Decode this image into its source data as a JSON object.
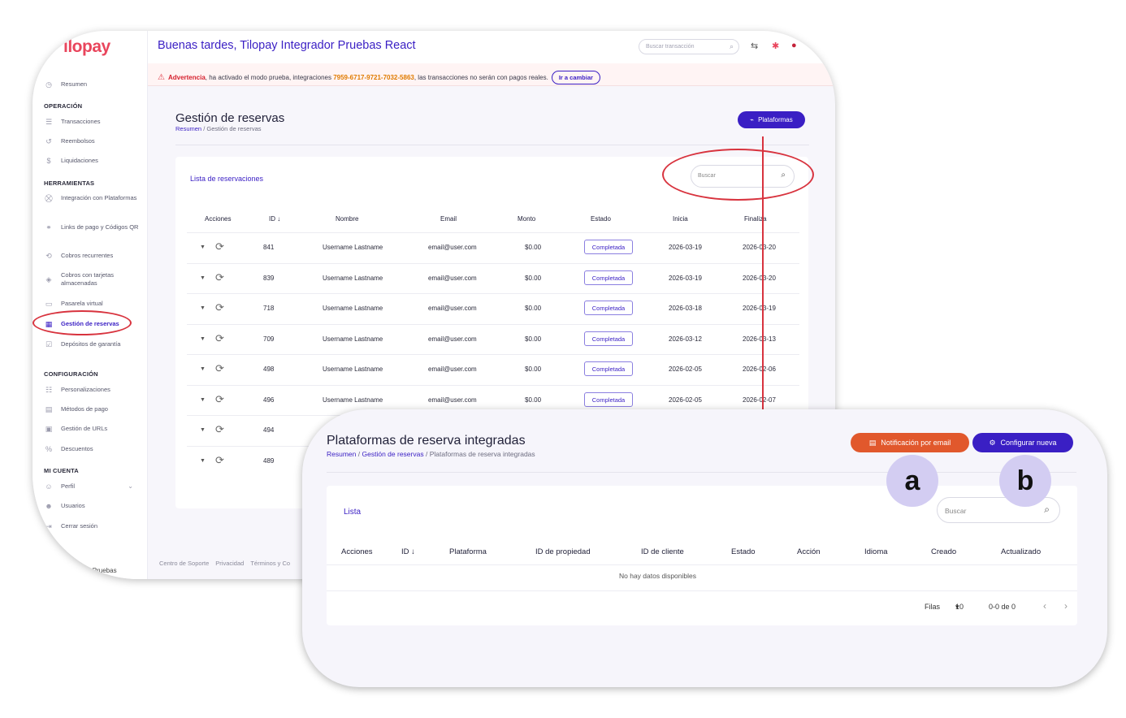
{
  "colors": {
    "brand": "#3a1fc4",
    "warning": "#d6222f",
    "orange": "#e1582c",
    "annotation": "#d8333e"
  },
  "back": {
    "logo": "ılopay",
    "greeting": "Buenas tardes, Tilopay Integrador Pruebas React",
    "top_search_placeholder": "Buscar transacción",
    "warning": {
      "label": "Advertencia",
      "text1": ", ha activado el modo prueba, integraciones ",
      "code": "7959-6717-9721-7032-5863",
      "text2": ", las transacciones no serán con pagos reales.",
      "button": "Ir a cambiar"
    },
    "sidebar": {
      "resumen": "Resumen",
      "sec_operacion": "OPERACIÓN",
      "transacciones": "Transacciones",
      "reembolsos": "Reembolsos",
      "liquidaciones": "Liquidaciones",
      "sec_herramientas": "HERRAMIENTAS",
      "integracion": "Integración con Plataformas",
      "links": "Links de pago y Códigos QR",
      "cobros_rec": "Cobros recurrentes",
      "cobros_tarj": "Cobros con tarjetas almacenadas",
      "pasarela": "Pasarela virtual",
      "gestion": "Gestión de reservas",
      "depositos": "Depósitos de garantía",
      "sec_config": "CONFIGURACIÓN",
      "personalizaciones": "Personalizaciones",
      "metodos": "Métodos de pago",
      "urls": "Gestión de URLs",
      "descuentos": "Descuentos",
      "sec_cuenta": "MI CUENTA",
      "perfil": "Perfil",
      "usuarios": "Usuarios",
      "cerrar": "Cerrar sesión",
      "footer_user": "dor Pruebas"
    },
    "page_title": "Gestión de reservas",
    "crumb_home": "Resumen",
    "crumb_sep": "/",
    "crumb_current": "Gestión de reservas",
    "plat_button": "Plataformas",
    "list_title": "Lista de reservaciones",
    "search_placeholder": "Buscar",
    "columns": {
      "acciones": "Acciones",
      "id": "ID ↓",
      "nombre": "Nombre",
      "email": "Email",
      "monto": "Monto",
      "estado": "Estado",
      "inicia": "Inicia",
      "finaliza": "Finaliza"
    },
    "rows": [
      {
        "id": "841",
        "nombre": "Username Lastname",
        "email": "email@user.com",
        "monto": "$0.00",
        "estado": "Completada",
        "inicia": "2026-03-19",
        "finaliza": "2026-03-20"
      },
      {
        "id": "839",
        "nombre": "Username Lastname",
        "email": "email@user.com",
        "monto": "$0.00",
        "estado": "Completada",
        "inicia": "2026-03-19",
        "finaliza": "2026-03-20"
      },
      {
        "id": "718",
        "nombre": "Username Lastname",
        "email": "email@user.com",
        "monto": "$0.00",
        "estado": "Completada",
        "inicia": "2026-03-18",
        "finaliza": "2026-03-19"
      },
      {
        "id": "709",
        "nombre": "Username Lastname",
        "email": "email@user.com",
        "monto": "$0.00",
        "estado": "Completada",
        "inicia": "2026-03-12",
        "finaliza": "2026-03-13"
      },
      {
        "id": "498",
        "nombre": "Username Lastname",
        "email": "email@user.com",
        "monto": "$0.00",
        "estado": "Completada",
        "inicia": "2026-02-05",
        "finaliza": "2026-02-06"
      },
      {
        "id": "496",
        "nombre": "Username Lastname",
        "email": "email@user.com",
        "monto": "$0.00",
        "estado": "Completada",
        "inicia": "2026-02-05",
        "finaliza": "2026-02-07"
      },
      {
        "id": "494"
      },
      {
        "id": "489"
      }
    ],
    "footer": {
      "soporte": "Centro de Soporte",
      "privacidad": "Privacidad",
      "terminos": "Términos y Co"
    }
  },
  "front": {
    "title": "Plataformas de reserva integradas",
    "crumb1": "Resumen",
    "crumb2": "Gestión de reservas",
    "crumb3": "Plataformas de reserva integradas",
    "sep": "/",
    "btn_email": "Notificación por email",
    "btn_config": "Configurar nueva",
    "mark_a": "a",
    "mark_b": "b",
    "list_title": "Lista",
    "search_placeholder": "Buscar",
    "columns": {
      "acciones": "Acciones",
      "id": "ID ↓",
      "plataforma": "Plataforma",
      "propiedad": "ID de propiedad",
      "cliente": "ID de cliente",
      "estado": "Estado",
      "accion": "Acción",
      "idioma": "Idioma",
      "creado": "Creado",
      "actualizado": "Actualizado"
    },
    "no_data": "No hay datos disponibles",
    "pager": {
      "filas_label": "Filas",
      "filas_value": "10",
      "range": "0-0 de 0"
    }
  }
}
